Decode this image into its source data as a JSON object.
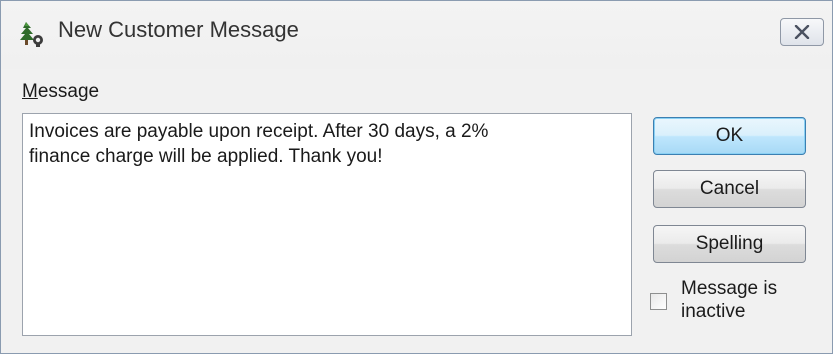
{
  "window": {
    "title": "New Customer Message",
    "close_icon": "close-icon",
    "app_icon": "quickbooks-tree-icon"
  },
  "form": {
    "message_label": "Message",
    "message_label_mnemonic": "M",
    "message_label_rest": "essage",
    "message_value": "Invoices are payable upon receipt. After 30 days, a 2%\nfinance charge will be applied. Thank you!"
  },
  "buttons": {
    "ok_label": "OK",
    "cancel_label": "Cancel",
    "spelling_label": "Spelling",
    "spelling_label_pre": "Spellin",
    "spelling_label_mnemonic": "g"
  },
  "options": {
    "inactive_label": "Message is inactive",
    "inactive_checked": false
  },
  "colors": {
    "default_button_border": "#3c7fb1",
    "window_background": "#f1f1f1"
  }
}
